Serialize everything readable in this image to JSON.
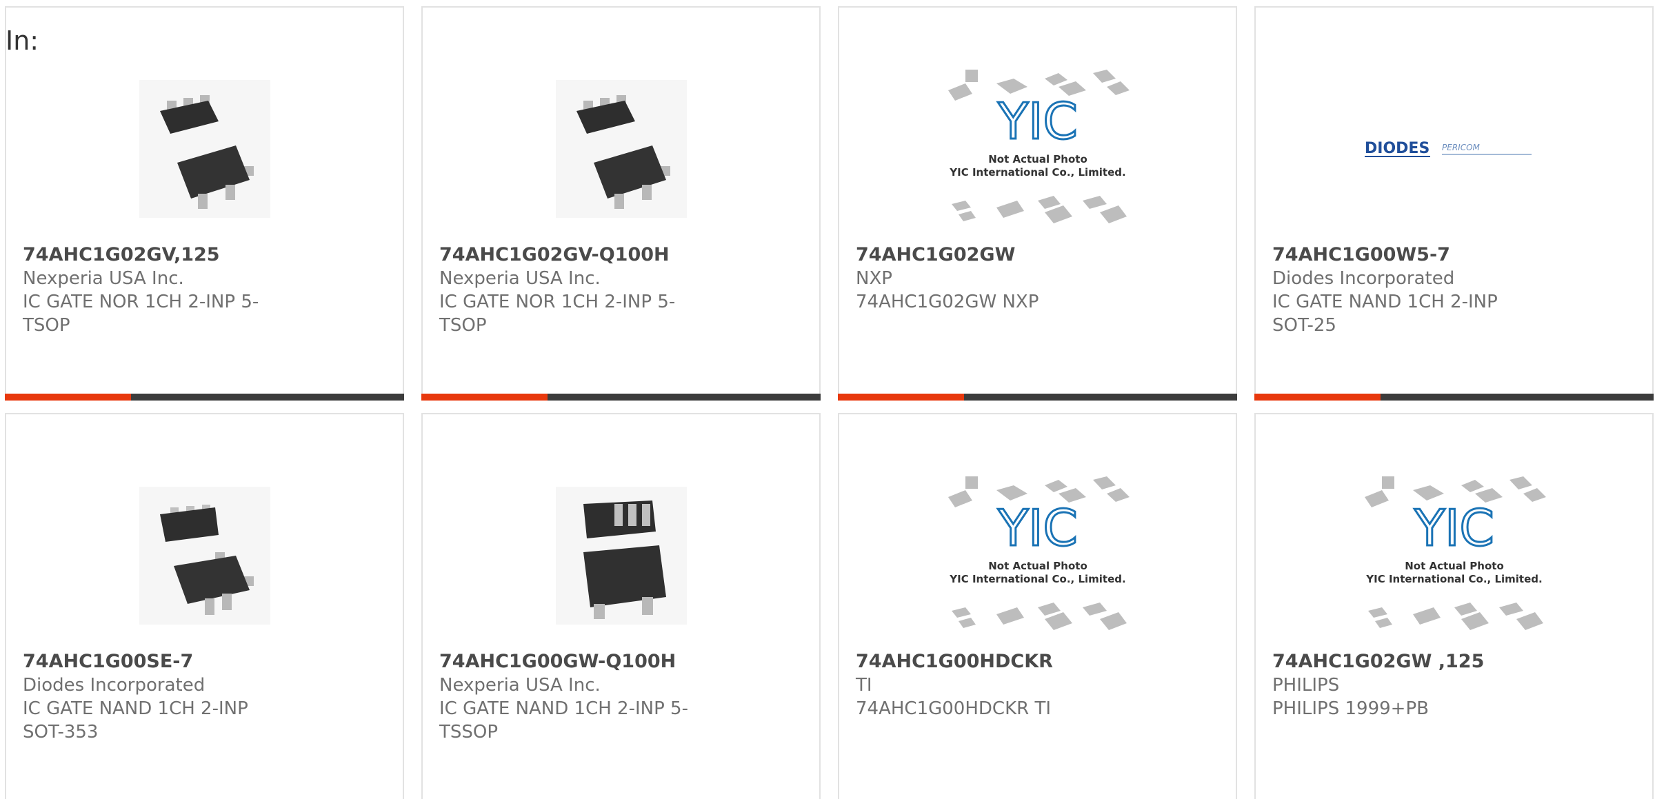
{
  "header": {
    "label": "In:"
  },
  "colors": {
    "accent": "#e8380d",
    "bar": "#3c3c3c",
    "border": "#e2e2e2"
  },
  "products": [
    {
      "part": "74AHC1G02GV,125",
      "maker": "Nexperia USA Inc.",
      "desc": "IC GATE NOR 1CH 2-INP 5-TSOP",
      "image": "sot-package-photo"
    },
    {
      "part": "74AHC1G02GV-Q100H",
      "maker": "Nexperia USA Inc.",
      "desc": "IC GATE NOR 1CH 2-INP 5-TSOP",
      "image": "sot-package-photo"
    },
    {
      "part": "74AHC1G02GW",
      "maker": "NXP",
      "desc": "74AHC1G02GW NXP",
      "image": "yic-placeholder"
    },
    {
      "part": "74AHC1G00W5-7",
      "maker": "Diodes Incorporated",
      "desc": "IC GATE NAND 1CH 2-INP SOT-25",
      "image": "diodes-pericom-logo"
    },
    {
      "part": "74AHC1G00SE-7",
      "maker": "Diodes Incorporated",
      "desc": "IC GATE NAND 1CH 2-INP SOT-353",
      "image": "sot-package-photo"
    },
    {
      "part": "74AHC1G00GW-Q100H",
      "maker": "Nexperia USA Inc.",
      "desc": "IC GATE NAND 1CH 2-INP 5-TSSOP",
      "image": "sot-package-photo"
    },
    {
      "part": "74AHC1G00HDCKR",
      "maker": "TI",
      "desc": "74AHC1G00HDCKR TI",
      "image": "yic-placeholder"
    },
    {
      "part": "74AHC1G02GW ,125",
      "maker": "PHILIPS",
      "desc": "PHILIPS 1999+PB",
      "image": "yic-placeholder"
    }
  ],
  "placeholder": {
    "logo": "YIC",
    "line1": "Not Actual Photo",
    "line2": "YIC International Co., Limited."
  },
  "diodes_logo": {
    "brand": "DIODES",
    "sub": "PERICOM"
  }
}
